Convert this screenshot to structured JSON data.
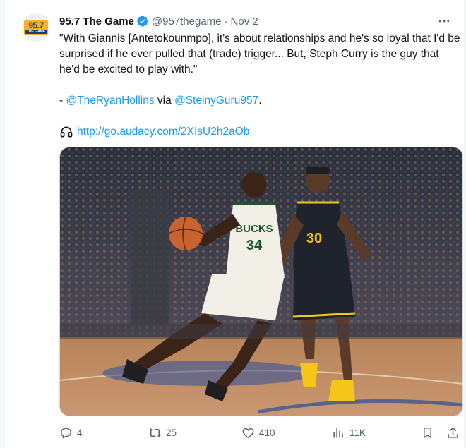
{
  "account": {
    "display_name": "95.7 The Game",
    "handle": "@957thegame",
    "separator": "·",
    "date": "Nov 2",
    "avatar_logo_top": "95.7",
    "avatar_logo_bottom": "THE GAME"
  },
  "tweet": {
    "quote": "\"With Giannis [Antetokounmpo], it's about relationships and he's so loyal that I'd be surprised if he ever pulled that (trade) trigger... But, Steph Curry is the guy that he'd be excited to play with.\"",
    "attribution_prefix": "- ",
    "mention_1": "@TheRyanHollins",
    "via_text": " via ",
    "mention_2": "@SteinyGuru957",
    "attribution_suffix": ".",
    "url": "http://go.audacy.com/2XIsU2h2aOb"
  },
  "media": {
    "jersey_bucks_text": "BUCKS",
    "jersey_bucks_number": "34",
    "jersey_warriors_number": "30"
  },
  "actions": {
    "replies": "4",
    "reposts": "25",
    "likes": "410",
    "views": "11K"
  },
  "icons": {
    "verified": "verified-badge-icon",
    "more": "more-options-icon",
    "headphones": "headphones-icon",
    "reply": "reply-icon",
    "repost": "repost-icon",
    "like": "heart-icon",
    "views": "views-icon",
    "bookmark": "bookmark-icon",
    "share": "share-icon"
  },
  "colors": {
    "link": "#1d9bf0",
    "verified": "#1d9bf0",
    "secondary_text": "#536471",
    "logo_gold": "#f4b321",
    "logo_navy": "#1a3c7a"
  }
}
